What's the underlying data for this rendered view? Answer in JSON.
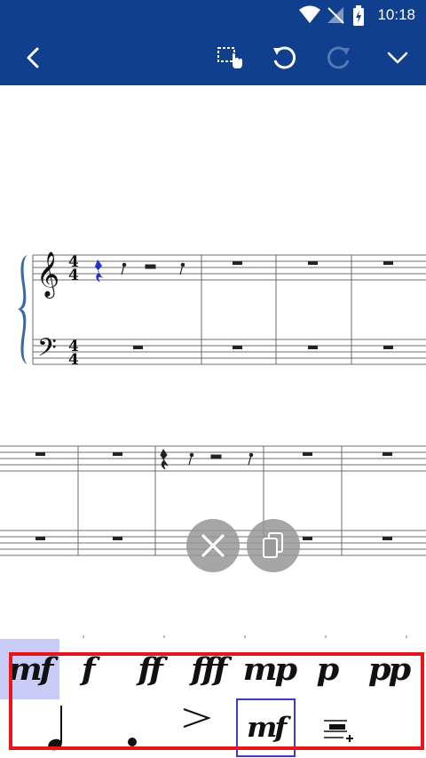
{
  "status_bar": {
    "time": "10:18",
    "icons": [
      "wifi-icon",
      "no-signal-icon",
      "battery-charging-icon"
    ]
  },
  "toolbar": {
    "buttons": [
      "back-icon",
      "select-region-icon",
      "undo-icon",
      "redo-icon",
      "collapse-chevron-icon"
    ]
  },
  "score": {
    "time_signature": {
      "numerator": "4",
      "denominator": "4"
    },
    "clefs": [
      "treble-clef",
      "bass-clef"
    ]
  },
  "floating_actions": [
    "close-icon",
    "copy-icon"
  ],
  "palette": {
    "dynamics": [
      "mf",
      "f",
      "ff",
      "fff",
      "mp",
      "p",
      "pp"
    ],
    "selected_dynamic": "mf",
    "articulations": [
      "quarter-note-icon",
      "staccato-dot-icon",
      "accent-icon",
      "dynamic-marking-icon",
      "add-staff-text-icon"
    ],
    "tool_label": "mf"
  },
  "colors": {
    "app_bar": "#0f3f8d",
    "palette_frame": "#e8161b",
    "selected_bg": "#c9ccf6",
    "selected_note": "#2233cc"
  }
}
